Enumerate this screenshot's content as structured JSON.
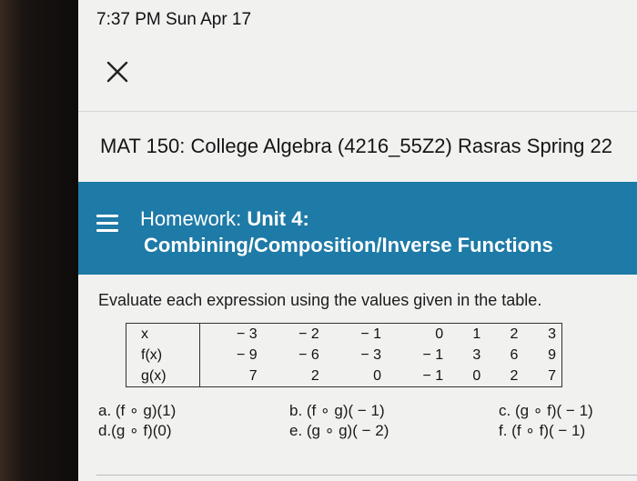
{
  "status": {
    "time_date": "7:37 PM  Sun Apr 17"
  },
  "header": {
    "close_icon": "close-icon"
  },
  "course": {
    "title": "MAT 150: College Algebra (4216_55Z2) Rasras Spring 22"
  },
  "banner": {
    "prefix": "Homework: ",
    "unit": "Unit 4:",
    "subtitle": "Combining/Composition/Inverse Functions",
    "menu_icon": "menu-icon"
  },
  "question": {
    "instruction": "Evaluate each expression using the values given in the table.",
    "table": {
      "rows": [
        {
          "label": "x",
          "values": [
            "− 3",
            "− 2",
            "− 1",
            "0",
            "1",
            "2",
            "3"
          ]
        },
        {
          "label": "f(x)",
          "values": [
            "− 9",
            "− 6",
            "− 3",
            "− 1",
            "3",
            "6",
            "9"
          ]
        },
        {
          "label": "g(x)",
          "values": [
            "7",
            "2",
            "0",
            "− 1",
            "0",
            "2",
            "7"
          ]
        }
      ]
    },
    "parts": {
      "a": "a. (f ∘ g)(1)",
      "b": "b. (f ∘ g)( − 1)",
      "c": "c. (g ∘ f)( − 1)",
      "d": "d.(g ∘ f)(0)",
      "e": "e. (g ∘ g)( − 2)",
      "f": "f. (f ∘ f)( − 1)"
    }
  },
  "colors": {
    "banner": "#1e7aa6",
    "background": "#f1f1f0"
  }
}
